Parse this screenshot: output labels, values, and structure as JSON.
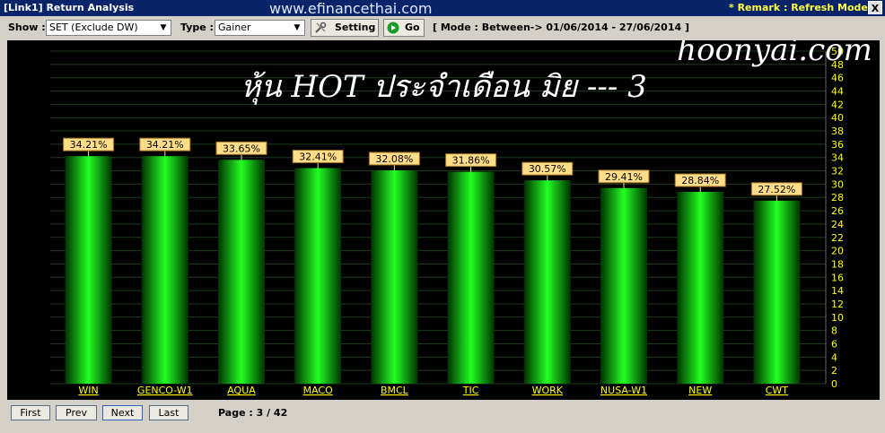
{
  "window": {
    "title": "[Link1] Return Analysis",
    "watermark": "www.efinancethai.com",
    "remark": "* Remark : Refresh Mode",
    "close_label": "X"
  },
  "toolbar": {
    "show_label": "Show :",
    "show_value": "SET (Exclude DW)",
    "type_label": "Type :",
    "type_value": "Gainer",
    "setting_label": "Setting",
    "go_label": "Go",
    "mode_text": "[ Mode : Between-> 01/06/2014 - 27/06/2014 ]"
  },
  "overlay": {
    "watermark_site": "hoonyai.com",
    "headline": "หุ้น HOT ประจำเดือน มิย --- 3"
  },
  "footer": {
    "first_label": "First",
    "prev_label": "Prev",
    "next_label": "Next",
    "last_label": "Last",
    "page_text": "Page : 3 / 42"
  },
  "colors": {
    "background": "#000000",
    "bar": "#00cc00",
    "label_bg": "#ffdd88",
    "axis_text": "#ffff00"
  },
  "chart_data": {
    "type": "bar",
    "categories": [
      "WIN",
      "GENCO-W1",
      "AQUA",
      "MACO",
      "BMCL",
      "TIC",
      "WORK",
      "NUSA-W1",
      "NEW",
      "CWT"
    ],
    "values": [
      34.21,
      34.21,
      33.65,
      32.41,
      32.08,
      31.86,
      30.57,
      29.41,
      28.84,
      27.52
    ],
    "value_labels": [
      "34.21%",
      "34.21%",
      "33.65%",
      "32.41%",
      "32.08%",
      "31.86%",
      "30.57%",
      "29.41%",
      "28.84%",
      "27.52%"
    ],
    "ylim": [
      0,
      50
    ],
    "yticks": [
      "0",
      "2",
      "4",
      "6",
      "8",
      "10",
      "12",
      "14",
      "16",
      "18",
      "20",
      "22",
      "24",
      "26",
      "28",
      "30",
      "32",
      "34",
      "36",
      "38",
      "40",
      "42",
      "44",
      "46",
      "48",
      "50"
    ],
    "grid": true,
    "y_axis_position": "right"
  }
}
